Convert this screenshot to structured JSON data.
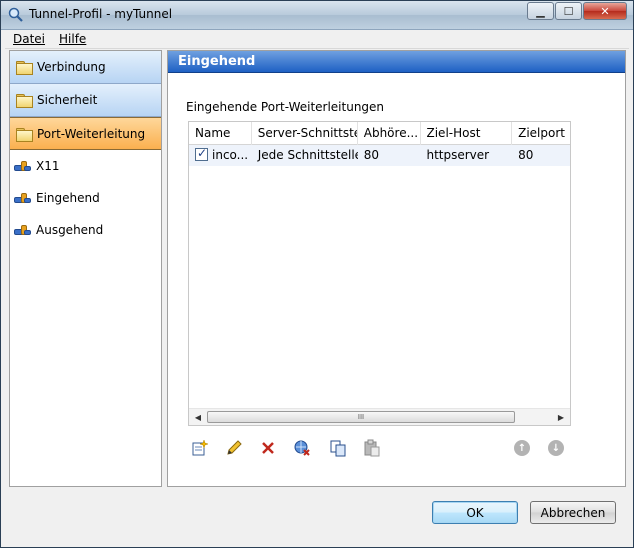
{
  "window": {
    "title": "Tunnel-Profil - myTunnel"
  },
  "menu": {
    "items": [
      {
        "label": "Datei"
      },
      {
        "label": "Hilfe"
      }
    ]
  },
  "nav": {
    "categories": [
      {
        "label": "Verbindung"
      },
      {
        "label": "Sicherheit"
      },
      {
        "label": "Port-Weiterleitung",
        "selected": true
      }
    ],
    "subitems": [
      {
        "label": "X11"
      },
      {
        "label": "Eingehend"
      },
      {
        "label": "Ausgehend"
      }
    ]
  },
  "content": {
    "header": "Eingehend",
    "section_label": "Eingehende Port-Weiterleitungen",
    "columns": [
      "Name",
      "Server-Schnittste...",
      "Abhöre...",
      "Ziel-Host",
      "Zielport"
    ],
    "rows": [
      {
        "checked": true,
        "name": "inco...",
        "interface": "Jede Schnittstelle",
        "listen": "80",
        "host": "httpserver",
        "port": "80"
      }
    ],
    "scrollbar_grip": "III"
  },
  "toolbar": {
    "icons": [
      "add-icon",
      "edit-icon",
      "delete-icon",
      "disconnect-icon",
      "copy-icon",
      "paste-icon",
      "move-up-icon",
      "move-down-icon"
    ],
    "up_glyph": "↑",
    "down_glyph": "↓"
  },
  "buttons": {
    "ok": "OK",
    "cancel": "Abbrechen"
  },
  "colors": {
    "selected_nav": "#fbb04f",
    "header_blue": "#1e60c4",
    "delete_red": "#c0281c"
  }
}
